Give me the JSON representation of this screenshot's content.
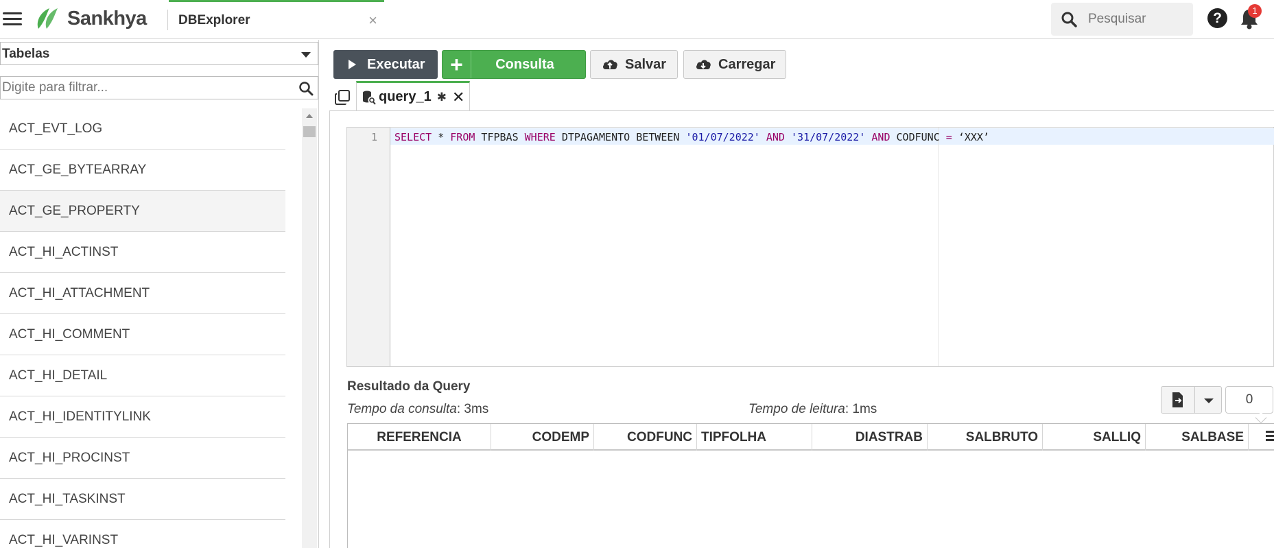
{
  "header": {
    "brand": "Sankhya",
    "app_tab": "DBExplorer",
    "app_tab_close": "×",
    "search_placeholder": "Pesquisar",
    "help": "?",
    "notifications": "1",
    "icons": [
      "hamburger-icon",
      "sankhya-logo",
      "search-icon",
      "help-icon",
      "bell-icon"
    ],
    "colors": {
      "brand_green": "#4caf50",
      "badge": "#e53935"
    }
  },
  "sidebar": {
    "object_type": "Tabelas",
    "filter_placeholder": "Digite para filtrar...",
    "tables": [
      "ACT_EVT_LOG",
      "ACT_GE_BYTEARRAY",
      "ACT_GE_PROPERTY",
      "ACT_HI_ACTINST",
      "ACT_HI_ATTACHMENT",
      "ACT_HI_COMMENT",
      "ACT_HI_DETAIL",
      "ACT_HI_IDENTITYLINK",
      "ACT_HI_PROCINST",
      "ACT_HI_TASKINST",
      "ACT_HI_VARINST"
    ],
    "highlighted_table": "ACT_GE_PROPERTY"
  },
  "toolbar": {
    "execute": "Executar",
    "new_query_plus": "+",
    "new_query": "Consulta",
    "save": "Salvar",
    "load": "Carregar"
  },
  "query_tab": {
    "label": "query_1",
    "modified_mark": "✱",
    "close": "✕"
  },
  "editor": {
    "line_number": "1",
    "tokens": [
      {
        "t": "SELECT",
        "c": "kw"
      },
      {
        "t": " * ",
        "c": ""
      },
      {
        "t": "FROM",
        "c": "kw"
      },
      {
        "t": " TFPBAS ",
        "c": ""
      },
      {
        "t": "WHERE",
        "c": "kw"
      },
      {
        "t": " DTPAGAMENTO BETWEEN ",
        "c": ""
      },
      {
        "t": "'01/07/2022'",
        "c": "str"
      },
      {
        "t": " ",
        "c": ""
      },
      {
        "t": "AND",
        "c": "kw"
      },
      {
        "t": " ",
        "c": ""
      },
      {
        "t": "'31/07/2022'",
        "c": "str"
      },
      {
        "t": " ",
        "c": ""
      },
      {
        "t": "AND",
        "c": "kw"
      },
      {
        "t": " CODFUNC ",
        "c": ""
      },
      {
        "t": "=",
        "c": "kw"
      },
      {
        "t": " ‘XXX’",
        "c": ""
      }
    ]
  },
  "results": {
    "title": "Resultado da Query",
    "query_time_label": "Tempo da consulta",
    "query_time_value": ": 3ms",
    "read_time_label": "Tempo de leitura",
    "read_time_value": ": 1ms",
    "row_count": "0",
    "columns": [
      "REFERENCIA",
      "CODEMP",
      "CODFUNC",
      "TIPFOLHA",
      "DIASTRAB",
      "SALBRUTO",
      "SALLIQ",
      "SALBASE"
    ]
  }
}
